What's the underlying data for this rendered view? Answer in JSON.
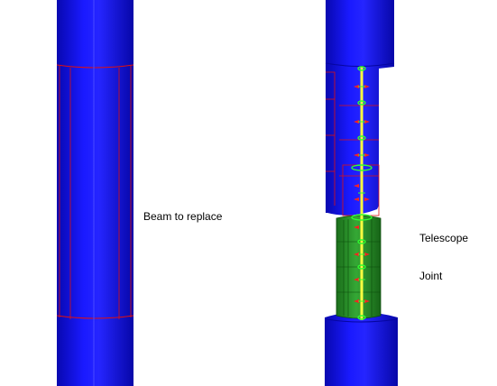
{
  "labels": {
    "beam": "Beam to replace",
    "telescope_line1": "Telescope",
    "telescope_line2": "Joint"
  },
  "colors": {
    "background": "#ffffff",
    "beam_blue": "#1010e8",
    "beam_blue_dark": "#0606a0",
    "beam_blue_light": "#3a3aff",
    "mesh_red": "#e01010",
    "joint_green": "#2e9a2e",
    "joint_green_dark": "#146014",
    "axis_yellow": "#ffff40",
    "node_green": "#30ff30",
    "arrow_red": "#ff2020"
  }
}
